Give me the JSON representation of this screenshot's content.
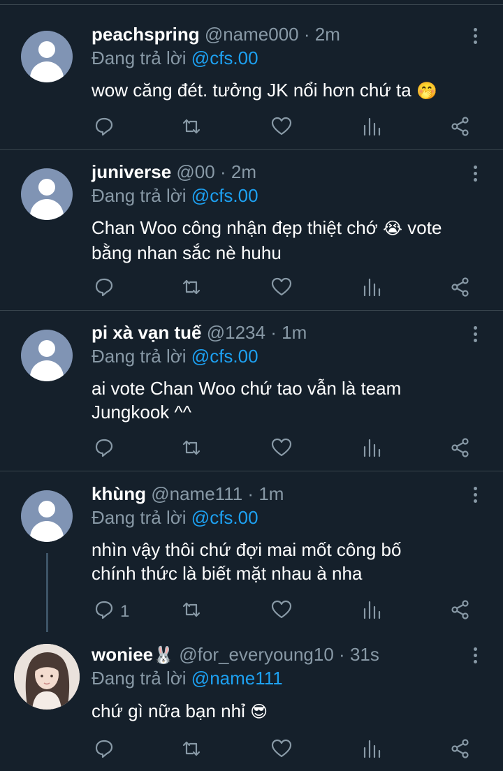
{
  "tweets": [
    {
      "name": "peachspring",
      "handle": "@name000",
      "time": "2m",
      "reply_prefix": "Đang trả lời",
      "reply_to": "@cfs.00",
      "text_1": "wow căng đét. tưởng JK nổi hơn chứ ta",
      "emoji": "🤭",
      "reply_count": ""
    },
    {
      "name": "juniverse",
      "handle": "@00",
      "time": "2m",
      "reply_prefix": "Đang trả lời",
      "reply_to": "@cfs.00",
      "text_1": "Chan Woo công nhận đẹp thiệt chớ",
      "emoji": "😭",
      "text_2": "vote",
      "text_3": "bằng nhan sắc nè huhu",
      "reply_count": ""
    },
    {
      "name": "pi xà vạn tuế",
      "handle": "@1234",
      "time": "1m",
      "reply_prefix": "Đang trả lời",
      "reply_to": "@cfs.00",
      "text_1": "ai vote Chan Woo chứ tao vẫn là team",
      "text_2": "Jungkook ^^",
      "reply_count": ""
    },
    {
      "name": "khùng",
      "handle": "@name111",
      "time": "1m",
      "reply_prefix": "Đang trả lời",
      "reply_to": "@cfs.00",
      "text_1": "nhìn vậy thôi chứ đợi mai mốt công bố",
      "text_2": "chính thức là biết mặt nhau à nha",
      "reply_count": "1"
    },
    {
      "name": "woniee",
      "name_emoji": "🐰",
      "handle": "@for_everyoung10",
      "time": "31s",
      "reply_prefix": "Đang trả lời",
      "reply_to": "@name111",
      "text_1": "chứ gì nữa bạn nhỉ",
      "emoji": "😎",
      "reply_count": ""
    }
  ],
  "separator": "·",
  "icons": [
    "reply-icon",
    "retweet-icon",
    "like-icon",
    "stats-icon",
    "share-icon",
    "more-icon"
  ],
  "colors": {
    "background": "#15202b",
    "secondary_text": "#8899a6",
    "link": "#1da1f2",
    "divider": "#38444d"
  }
}
